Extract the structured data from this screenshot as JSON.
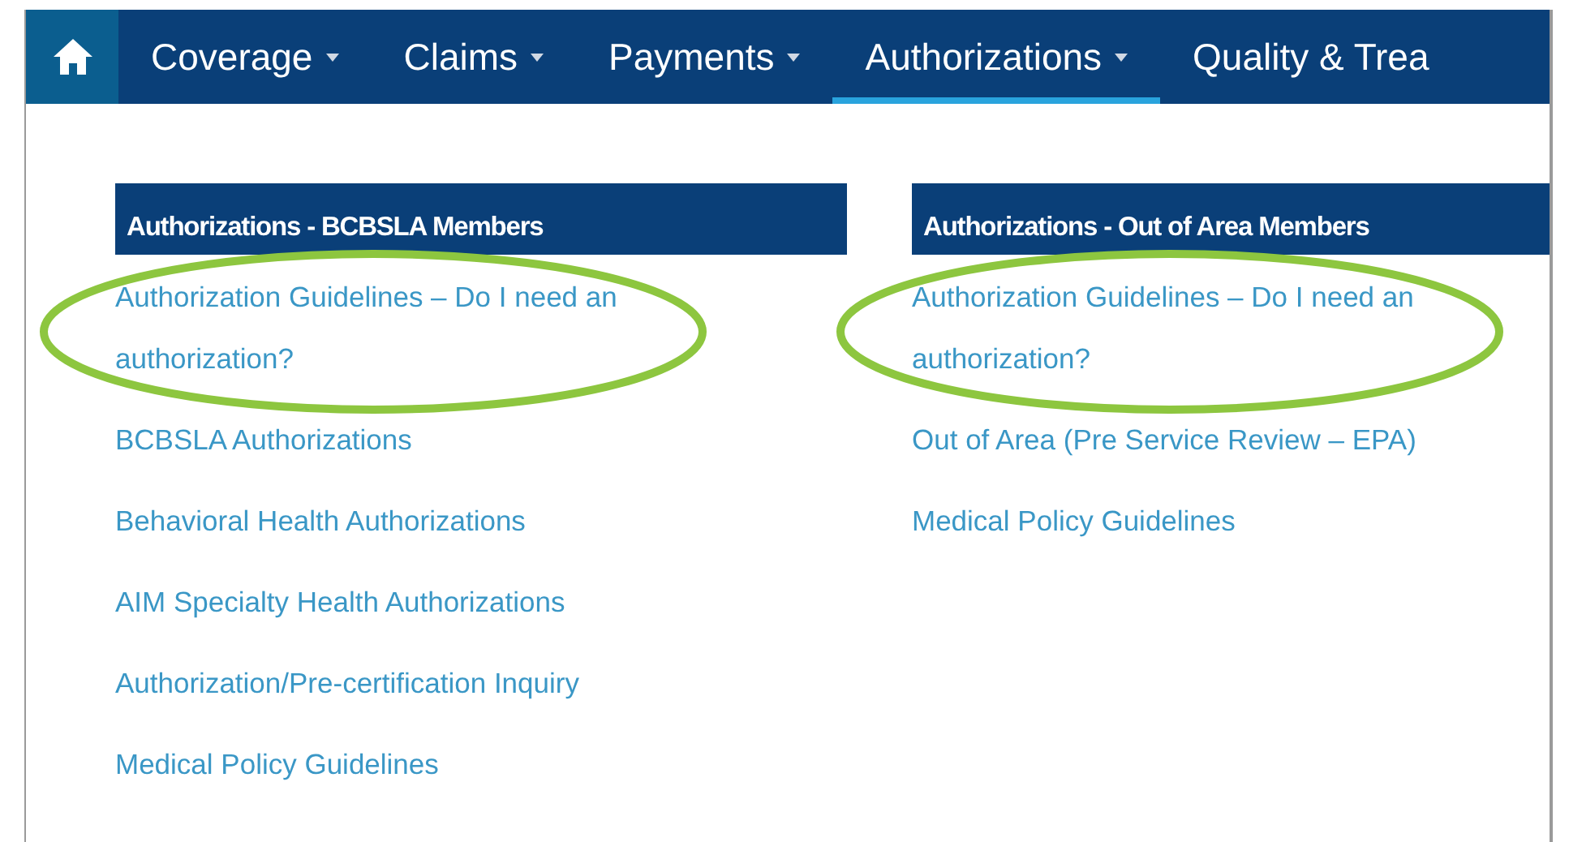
{
  "nav": {
    "items": [
      {
        "label": "Coverage",
        "selected": false
      },
      {
        "label": "Claims",
        "selected": false
      },
      {
        "label": "Payments",
        "selected": false
      },
      {
        "label": "Authorizations",
        "selected": true
      },
      {
        "label": "Quality & Trea",
        "selected": false
      }
    ]
  },
  "columns": [
    {
      "title": "Authorizations - BCBSLA Members",
      "links": [
        {
          "label": "Authorization Guidelines – Do I need an authorization?",
          "highlighted": true
        },
        {
          "label": "BCBSLA Authorizations",
          "highlighted": false
        },
        {
          "label": "Behavioral Health Authorizations",
          "highlighted": false
        },
        {
          "label": "AIM Specialty Health Authorizations",
          "highlighted": false
        },
        {
          "label": "Authorization/Pre-certification Inquiry",
          "highlighted": false
        },
        {
          "label": "Medical Policy Guidelines",
          "highlighted": false
        }
      ]
    },
    {
      "title": "Authorizations - Out of Area Members",
      "links": [
        {
          "label": "Authorization Guidelines – Do I need an authorization?",
          "highlighted": true
        },
        {
          "label": "Out of Area (Pre Service Review – EPA)",
          "highlighted": false
        },
        {
          "label": "Medical Policy Guidelines",
          "highlighted": false
        }
      ]
    }
  ]
}
